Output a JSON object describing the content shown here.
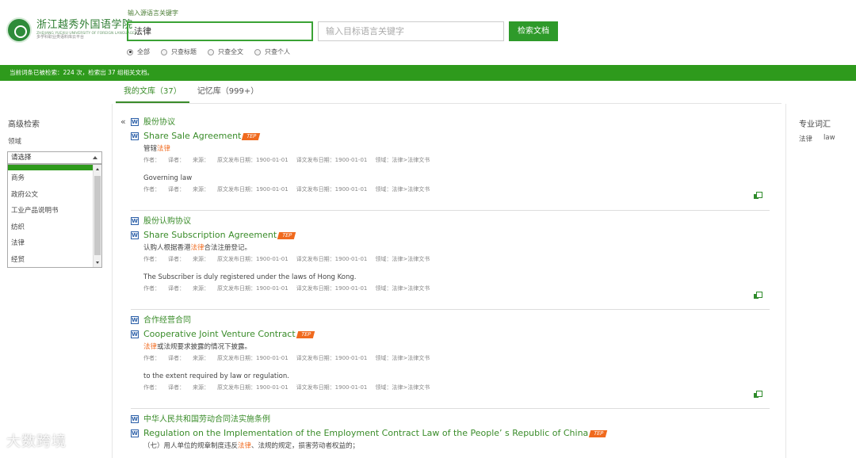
{
  "header": {
    "logo_cn": "浙江越秀外国语学院",
    "logo_en": "ZHEJIANG YUEXIU UNIVERSITY OF FOREIGN LANGUAGES",
    "logo_sub": "多学科职业类语料库云平台",
    "source_label": "输入源语言关键字",
    "source_value": "法律",
    "target_placeholder": "输入目标语言关键字",
    "search_button": "检索文档",
    "radios": [
      {
        "label": "全部",
        "checked": true
      },
      {
        "label": "只查标题",
        "checked": false
      },
      {
        "label": "只查全文",
        "checked": false
      },
      {
        "label": "只查个人",
        "checked": false
      }
    ]
  },
  "status_bar": "当前词条已被检索：224 次，检索出 37 组相关文档。",
  "tabs": [
    {
      "label": "我的文库（37）",
      "active": true
    },
    {
      "label": "记忆库（999+）",
      "active": false
    }
  ],
  "left": {
    "title": "高级检索",
    "domain_label": "领域",
    "select_value": "请选择",
    "list_items": [
      "商务",
      "政府公文",
      "工业产品说明书",
      "纺织",
      "法律",
      "经贸"
    ]
  },
  "right": {
    "title": "专业词汇",
    "term_cn": "法律",
    "term_en": "law"
  },
  "collapse_icon": "«",
  "doc_icon": "W",
  "tep_badge": "TEP",
  "meta_labels": {
    "author": "作者：",
    "translator": "译者：",
    "source": "来源：",
    "orig_date": "原文发布日期：1900-01-01",
    "trans_date": "译文发布日期：1900-01-01",
    "domain": "领域：法律>法律文书"
  },
  "results": [
    {
      "title_cn": "股份协议",
      "title_en": "Share Sale Agreement",
      "src_before": "管辖",
      "src_hl": "法律",
      "src_after": "",
      "tgt": "Governing law"
    },
    {
      "title_cn": "股份认购协议",
      "title_en": "Share Subscription Agreement",
      "src_before": "认购人根据香港",
      "src_hl": "法律",
      "src_after": "合法注册登记。",
      "tgt": "The Subscriber is duly registered under the laws of Hong Kong."
    },
    {
      "title_cn": "合作经营合同",
      "title_en": "Cooperative Joint Venture Contract",
      "src_before": "",
      "src_hl": "法律",
      "src_after": "或法规要求披露的情况下披露。",
      "tgt": "to the extent required by law or regulation."
    },
    {
      "title_cn": "中华人民共和国劳动合同法实施条例",
      "title_en": "Regulation on the Implementation of the Employment Contract Law of the People’ s Republic of China",
      "src_before": "（七）用人单位的规章制度违反",
      "src_hl": "法律",
      "src_after": "、法规的规定，损害劳动者权益的；"
    }
  ],
  "watermark": "大数跨境"
}
